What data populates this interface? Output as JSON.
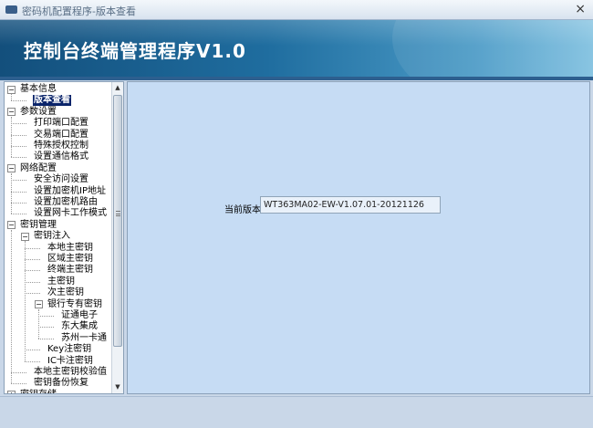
{
  "window": {
    "title": "密码机配置程序-版本查看",
    "close_glyph": "×"
  },
  "banner": {
    "title": "控制台终端管理程序V1.0"
  },
  "tree": {
    "nodes": [
      {
        "label": "基本信息",
        "level": 0,
        "toggle": "−"
      },
      {
        "label": "版本查看",
        "level": 1,
        "selected": true
      },
      {
        "label": "参数设置",
        "level": 0,
        "toggle": "−"
      },
      {
        "label": "打印端口配置",
        "level": 1
      },
      {
        "label": "交易端口配置",
        "level": 1
      },
      {
        "label": "特殊授权控制",
        "level": 1
      },
      {
        "label": "设置通信格式",
        "level": 1
      },
      {
        "label": "网络配置",
        "level": 0,
        "toggle": "−"
      },
      {
        "label": "安全访问设置",
        "level": 1
      },
      {
        "label": "设置加密机IP地址",
        "level": 1
      },
      {
        "label": "设置加密机路由",
        "level": 1
      },
      {
        "label": "设置网卡工作模式",
        "level": 1
      },
      {
        "label": "密钥管理",
        "level": 0,
        "toggle": "−"
      },
      {
        "label": "密钥注入",
        "level": 1,
        "toggle": "−"
      },
      {
        "label": "本地主密钥",
        "level": 2
      },
      {
        "label": "区域主密钥",
        "level": 2
      },
      {
        "label": "终端主密钥",
        "level": 2
      },
      {
        "label": "主密钥",
        "level": 2
      },
      {
        "label": "次主密钥",
        "level": 2
      },
      {
        "label": "银行专有密钥",
        "level": 2,
        "toggle": "−"
      },
      {
        "label": "证通电子",
        "level": 3
      },
      {
        "label": "东大集成",
        "level": 3
      },
      {
        "label": "苏州一卡通",
        "level": 3
      },
      {
        "label": "Key注密钥",
        "level": 2
      },
      {
        "label": "IC卡注密钥",
        "level": 2
      },
      {
        "label": "本地主密钥校验值",
        "level": 1
      },
      {
        "label": "密钥备份恢复",
        "level": 1
      },
      {
        "label": "密钥存储",
        "level": 0,
        "toggle": "+"
      }
    ],
    "scroll_up_glyph": "▲",
    "scroll_down_glyph": "▼"
  },
  "panel": {
    "version_label": "当前版本",
    "version_value": "WT363MA02-EW-V1.07.01-20121126"
  }
}
